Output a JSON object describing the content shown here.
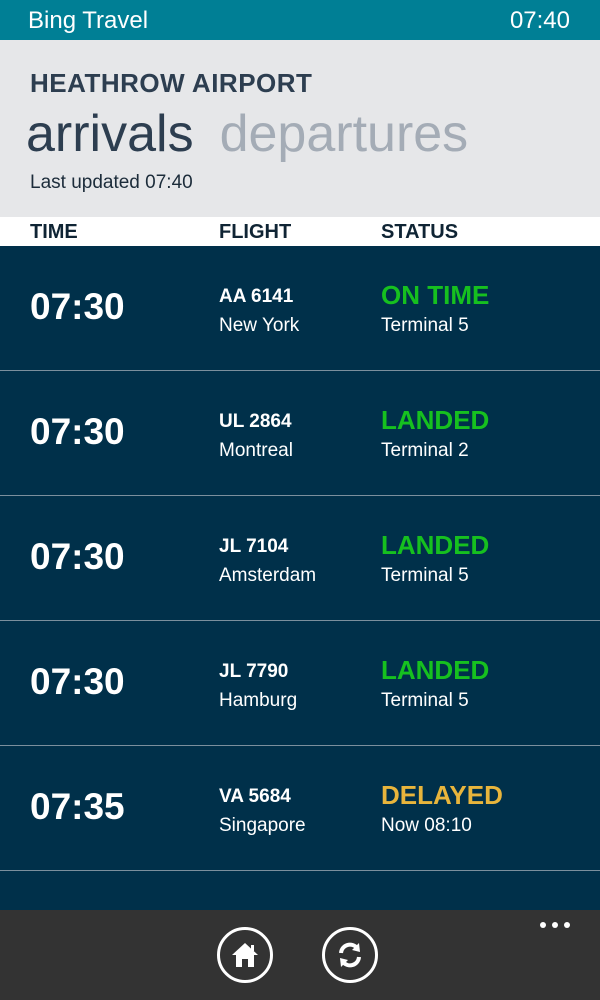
{
  "status_bar": {
    "app_title": "Bing Travel",
    "clock": "07:40"
  },
  "header": {
    "airport": "HEATHROW AIRPORT",
    "tabs": [
      {
        "label": "arrivals",
        "active": true
      },
      {
        "label": "departures",
        "active": false
      }
    ],
    "last_updated": "Last updated 07:40"
  },
  "columns": {
    "time": "TIME",
    "flight": "FLIGHT",
    "status": "STATUS"
  },
  "colors": {
    "on_time": "#16c01f",
    "landed": "#16c01f",
    "delayed": "#e8b53c"
  },
  "flights": [
    {
      "time": "07:30",
      "flight": "AA 6141",
      "city": "New York",
      "status": "ON TIME",
      "detail": "Terminal 5",
      "status_color": "#16c01f"
    },
    {
      "time": "07:30",
      "flight": "UL 2864",
      "city": "Montreal",
      "status": "LANDED",
      "detail": "Terminal 2",
      "status_color": "#16c01f"
    },
    {
      "time": "07:30",
      "flight": "JL 7104",
      "city": "Amsterdam",
      "status": "LANDED",
      "detail": "Terminal 5",
      "status_color": "#16c01f"
    },
    {
      "time": "07:30",
      "flight": "JL 7790",
      "city": "Hamburg",
      "status": "LANDED",
      "detail": "Terminal 5",
      "status_color": "#16c01f"
    },
    {
      "time": "07:35",
      "flight": "VA 5684",
      "city": "Singapore",
      "status": "DELAYED",
      "detail": "Now 08:10",
      "status_color": "#e8b53c"
    }
  ],
  "appbar": {
    "buttons": [
      {
        "icon": "home-icon"
      },
      {
        "icon": "refresh-icon"
      }
    ],
    "more": "more-options-icon"
  }
}
